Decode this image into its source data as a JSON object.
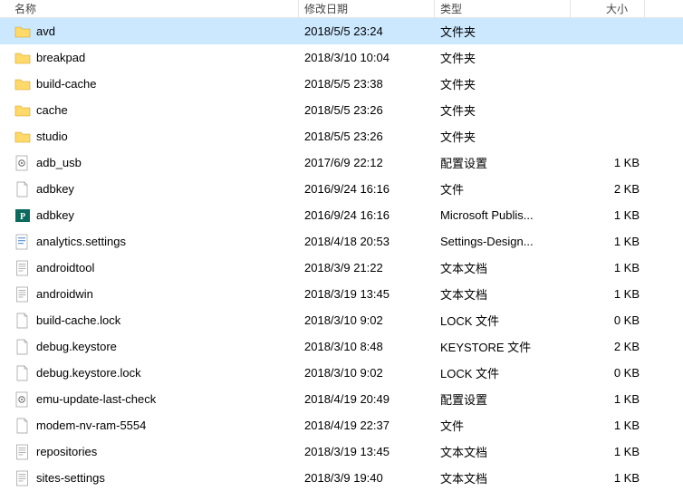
{
  "header": {
    "name": "名称",
    "date": "修改日期",
    "type": "类型",
    "size": "大小"
  },
  "icons": {
    "folder": "folder",
    "config": "config",
    "file": "file",
    "publisher": "publisher",
    "settings": "settings",
    "text": "text",
    "generic": "generic"
  },
  "rows": [
    {
      "name": "avd",
      "date": "2018/5/5 23:24",
      "type": "文件夹",
      "size": "",
      "icon": "folder",
      "selected": true
    },
    {
      "name": "breakpad",
      "date": "2018/3/10 10:04",
      "type": "文件夹",
      "size": "",
      "icon": "folder",
      "selected": false
    },
    {
      "name": "build-cache",
      "date": "2018/5/5 23:38",
      "type": "文件夹",
      "size": "",
      "icon": "folder",
      "selected": false
    },
    {
      "name": "cache",
      "date": "2018/5/5 23:26",
      "type": "文件夹",
      "size": "",
      "icon": "folder",
      "selected": false
    },
    {
      "name": "studio",
      "date": "2018/5/5 23:26",
      "type": "文件夹",
      "size": "",
      "icon": "folder",
      "selected": false
    },
    {
      "name": "adb_usb",
      "date": "2017/6/9 22:12",
      "type": "配置设置",
      "size": "1 KB",
      "icon": "config",
      "selected": false
    },
    {
      "name": "adbkey",
      "date": "2016/9/24 16:16",
      "type": "文件",
      "size": "2 KB",
      "icon": "generic",
      "selected": false
    },
    {
      "name": "adbkey",
      "date": "2016/9/24 16:16",
      "type": "Microsoft Publis...",
      "size": "1 KB",
      "icon": "publisher",
      "selected": false
    },
    {
      "name": "analytics.settings",
      "date": "2018/4/18 20:53",
      "type": "Settings-Design...",
      "size": "1 KB",
      "icon": "settings",
      "selected": false
    },
    {
      "name": "androidtool",
      "date": "2018/3/9 21:22",
      "type": "文本文档",
      "size": "1 KB",
      "icon": "text",
      "selected": false
    },
    {
      "name": "androidwin",
      "date": "2018/3/19 13:45",
      "type": "文本文档",
      "size": "1 KB",
      "icon": "text",
      "selected": false
    },
    {
      "name": "build-cache.lock",
      "date": "2018/3/10 9:02",
      "type": "LOCK 文件",
      "size": "0 KB",
      "icon": "generic",
      "selected": false
    },
    {
      "name": "debug.keystore",
      "date": "2018/3/10 8:48",
      "type": "KEYSTORE 文件",
      "size": "2 KB",
      "icon": "generic",
      "selected": false
    },
    {
      "name": "debug.keystore.lock",
      "date": "2018/3/10 9:02",
      "type": "LOCK 文件",
      "size": "0 KB",
      "icon": "generic",
      "selected": false
    },
    {
      "name": "emu-update-last-check",
      "date": "2018/4/19 20:49",
      "type": "配置设置",
      "size": "1 KB",
      "icon": "config",
      "selected": false
    },
    {
      "name": "modem-nv-ram-5554",
      "date": "2018/4/19 22:37",
      "type": "文件",
      "size": "1 KB",
      "icon": "generic",
      "selected": false
    },
    {
      "name": "repositories",
      "date": "2018/3/19 13:45",
      "type": "文本文档",
      "size": "1 KB",
      "icon": "text",
      "selected": false
    },
    {
      "name": "sites-settings",
      "date": "2018/3/9 19:40",
      "type": "文本文档",
      "size": "1 KB",
      "icon": "text",
      "selected": false
    }
  ]
}
